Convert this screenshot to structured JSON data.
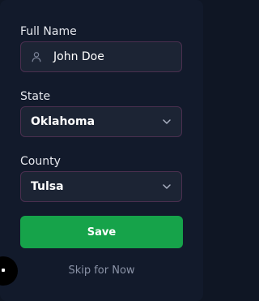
{
  "form": {
    "full_name": {
      "label": "Full Name",
      "value": "John Doe",
      "icon": "user-icon"
    },
    "state": {
      "label": "State",
      "selected": "Oklahoma",
      "icon": "chevron-down-icon"
    },
    "county": {
      "label": "County",
      "selected": "Tulsa",
      "icon": "chevron-down-icon"
    },
    "save_label": "Save",
    "skip_label": "Skip for Now"
  },
  "colors": {
    "background": "#121a2b",
    "field_background": "#1c2434",
    "field_border": "#4a2f4f",
    "primary_button": "#16a34a",
    "muted_text": "#8b93a7"
  }
}
